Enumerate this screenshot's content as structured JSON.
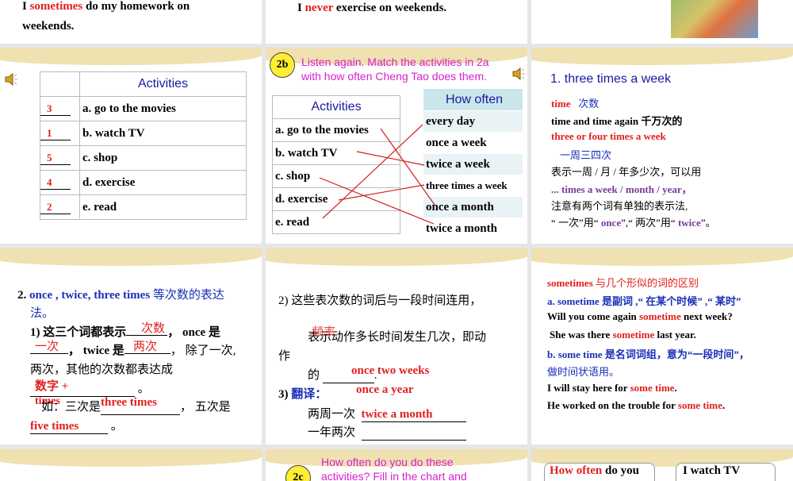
{
  "row0": {
    "s1": {
      "pre": "I ",
      "red": "sometimes",
      "post": " do my homework on",
      "line2": "weekends."
    },
    "s2": {
      "pre": "I ",
      "red": "never",
      "post": " exercise on weekends."
    }
  },
  "s2a": {
    "header": "Activities",
    "rows": [
      {
        "answer": "3",
        "label": "a.  go to the movies"
      },
      {
        "answer": "1",
        "label": "b.  watch TV"
      },
      {
        "answer": "5",
        "label": "c.  shop"
      },
      {
        "answer": "4",
        "label": "d.  exercise"
      },
      {
        "answer": "2",
        "label": "e.  read"
      }
    ]
  },
  "s2b": {
    "badge": "2b",
    "instruction1": "Listen again. Match the activities in 2a",
    "instruction2": "with how often Cheng Tao does them.",
    "activities_header": "Activities",
    "activities": [
      "a.  go to the movies",
      "b.  watch TV",
      "c.  shop",
      "d.  exercise",
      "e.  read"
    ],
    "often_header": "How often",
    "often": [
      "every day",
      "once a week",
      "twice a week",
      "three times a week",
      "once a month",
      "twice a month"
    ]
  },
  "s3": {
    "title": "1. three times a week",
    "l1a": "time",
    "l1b": "次数",
    "l2": "time and time again   千万次的",
    "l3": "three or four times a week",
    "l4": "一周三四次",
    "l5": "表示一周 / 月 / 年多少次，可以用",
    "l6": "... times a week / month / year，",
    "l7": "注意有两个词有单独的表示法,",
    "l8a": "“ 一次”用“ ",
    "l8b": "once",
    "l8c": "”,“ 两次”用“ ",
    "l8d": "twice",
    "l8e": "”。"
  },
  "s4": {
    "num": "2. ",
    "title": "once , twice, three times",
    "title_cn": "等次数的表达",
    "title_cn2": "法。",
    "l1": "1)  这三个词都表示",
    "a1": "次数",
    "l1b": "，  once 是",
    "a2": "一次",
    "l2": "，  twice 是",
    "a3": "两次",
    "l2b": "，  除了一次,",
    "l3": "两次，其他的次数都表达成",
    "a4": "数字  +",
    "a4b": "times",
    "l4": "。",
    "l5": "如：三次是",
    "a5": "three times",
    "l5b": "，  五次是",
    "a6": "five times",
    "l6": "。"
  },
  "s5": {
    "l1": "2)  这些表次数的词后与一段时间连用，",
    "a1": "频率",
    "l2": "表示动作多长时间发生几次，即动",
    "l3": "作",
    "l4": "的",
    "a2": "once two weeks",
    "l4b": ".",
    "l5num": "3)  ",
    "l5": "翻译：",
    "a3": "once a year",
    "l6": "两周一次",
    "a4": "twice a month",
    "l7": "一年两次"
  },
  "s6": {
    "l1a": "sometimes",
    "l1b": " 与几个形似的词的区别",
    "l2": "a. sometime 是副词 ,“ 在某个时候” ,“ 某时”",
    "l3a": "Will you come again ",
    "l3b": "sometime",
    "l3c": " next week?",
    "l4a": "She was there ",
    "l4b": "sometime",
    "l4c": " last year.",
    "l5": "b. some time 是名词词组，意为“一段时间”，",
    "l6": "做时间状语用。",
    "l7a": "I will stay here for ",
    "l7b": "some time",
    "l7c": ".",
    "l8a": "He worked on the trouble for ",
    "l8b": "some time",
    "l8c": "."
  },
  "row3": {
    "badge": "2c",
    "instruction1": "How often do you do these",
    "instruction2": "activities? Fill in the chart and",
    "box1a": "How often",
    "box1b": " do you",
    "box2": "I watch TV"
  }
}
